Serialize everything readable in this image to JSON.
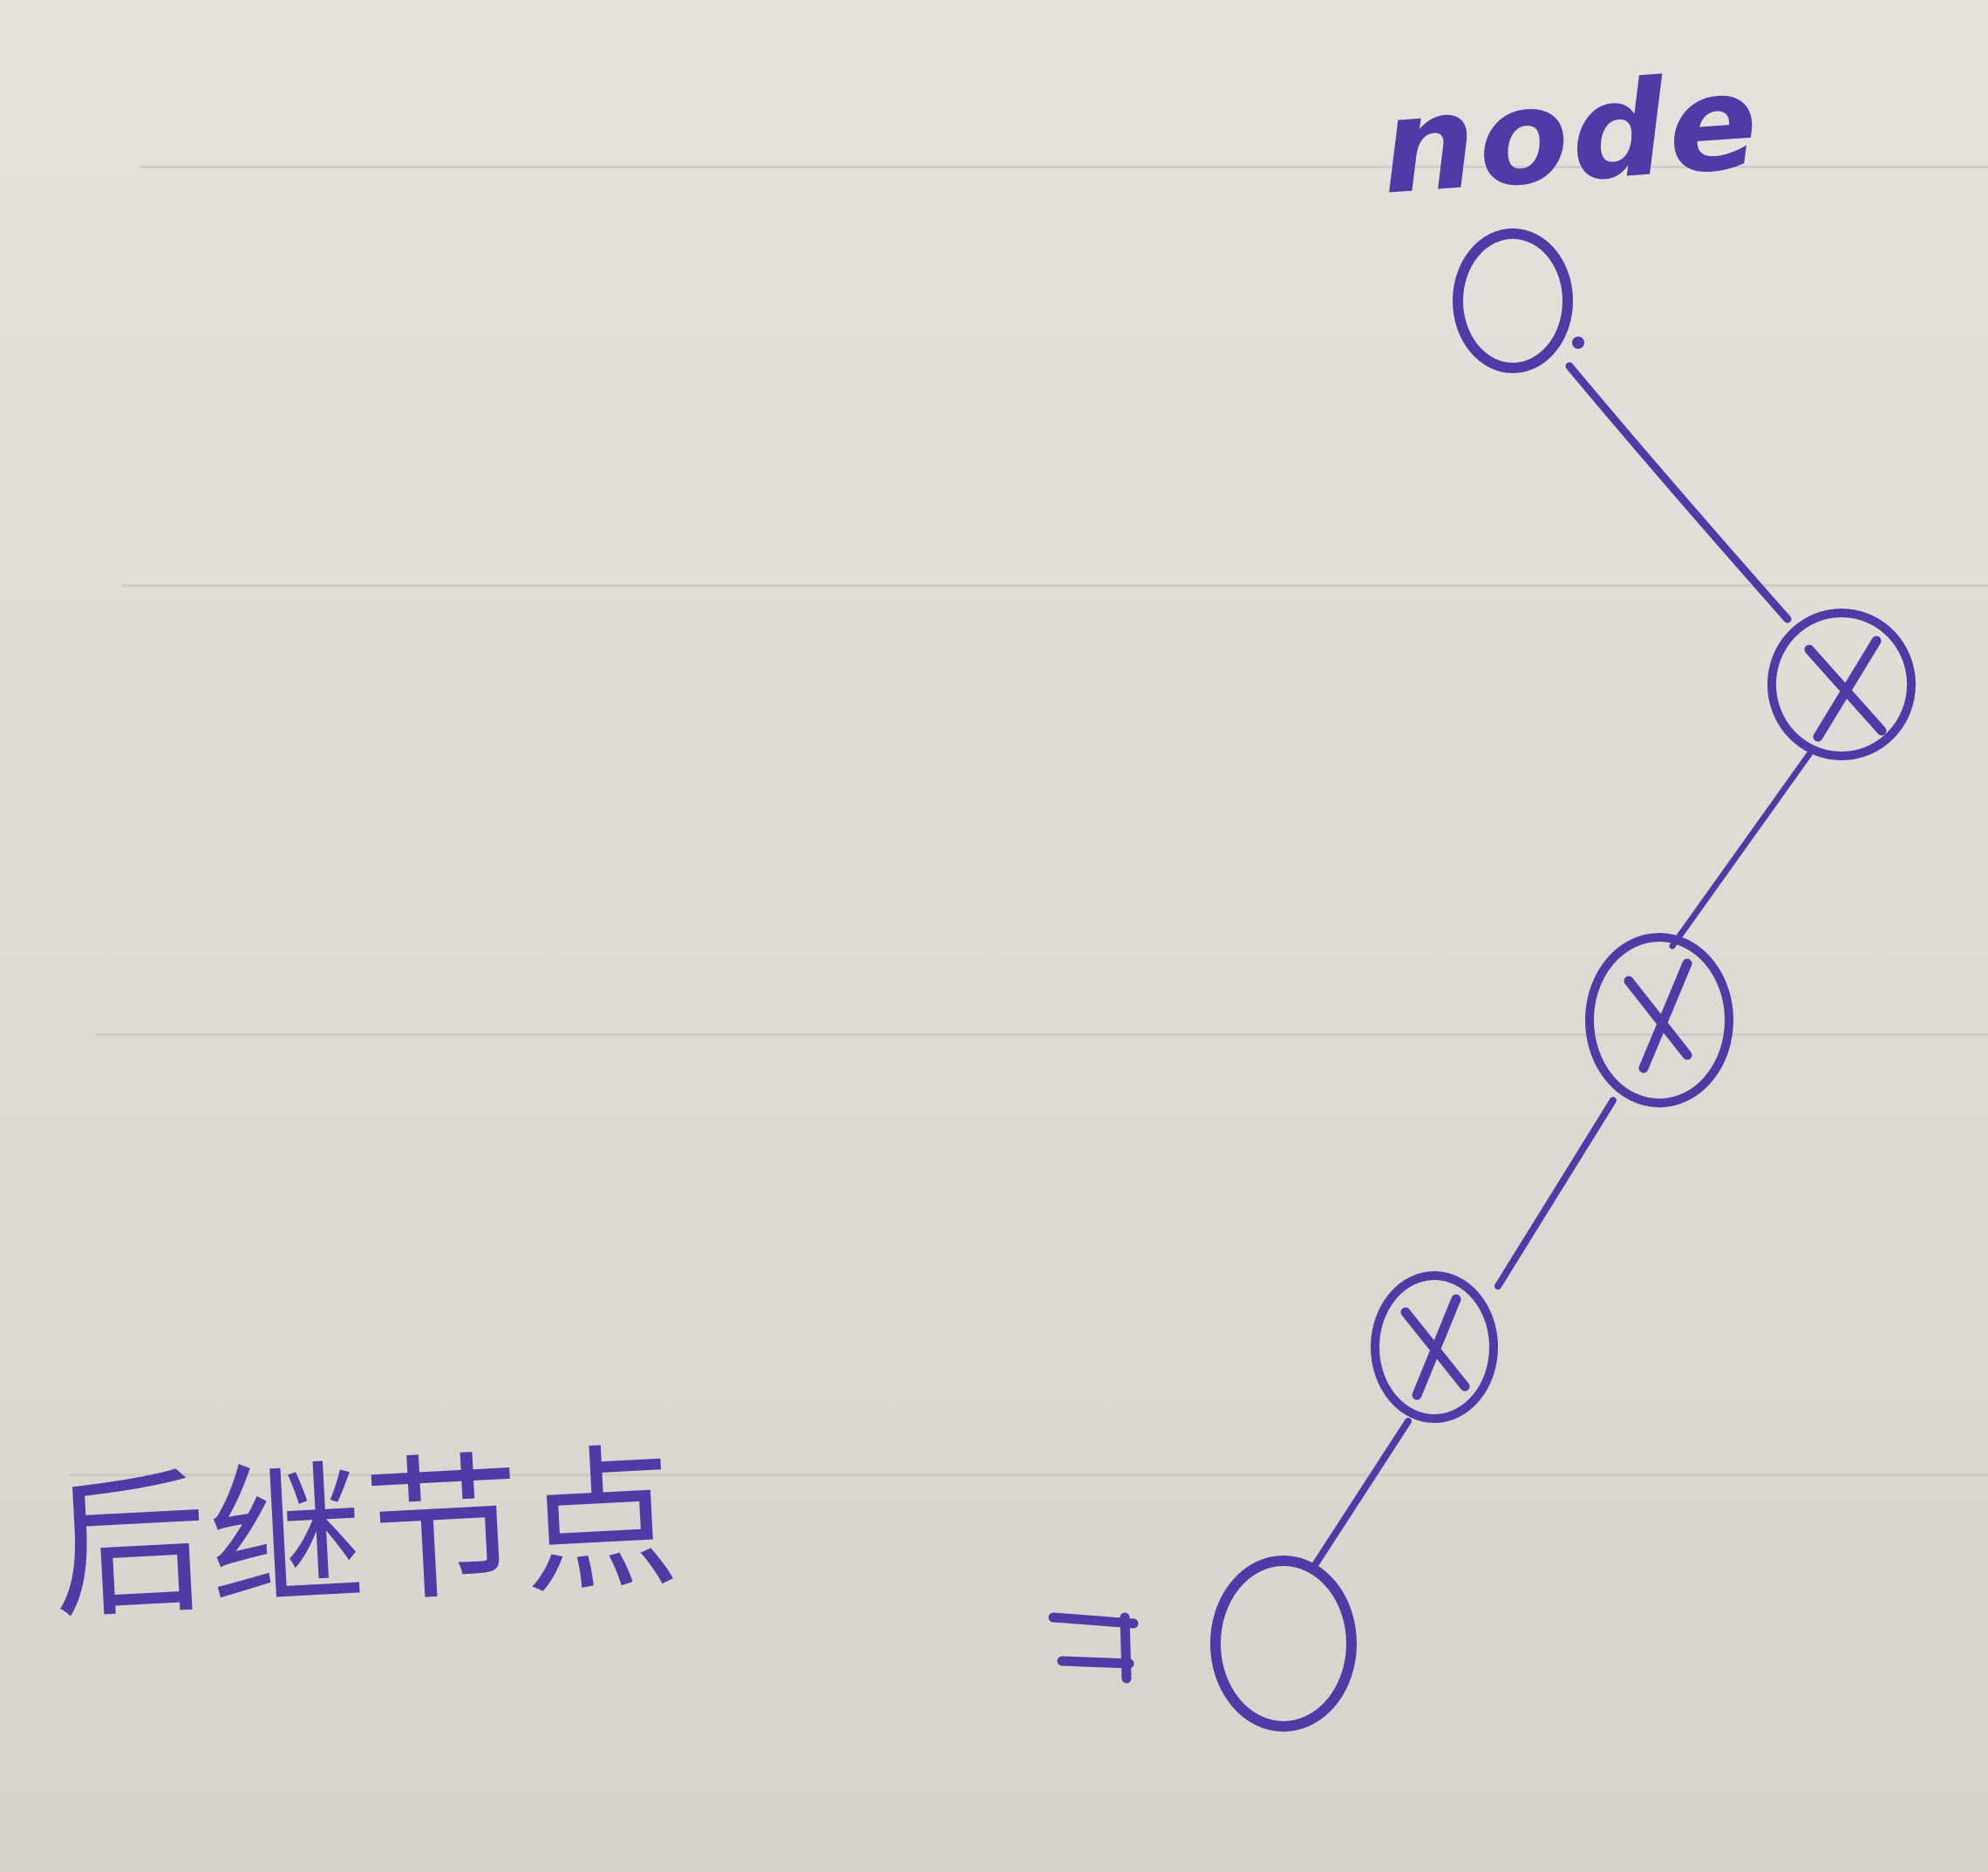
{
  "labels": {
    "top": "node",
    "bottom": "后继节点"
  },
  "nodes": [
    {
      "id": "node",
      "marked": false
    },
    {
      "id": "x1",
      "marked": true
    },
    {
      "id": "x2",
      "marked": true
    },
    {
      "id": "x3",
      "marked": true
    },
    {
      "id": "successor",
      "marked": false
    }
  ],
  "edges": [
    [
      "node",
      "x1"
    ],
    [
      "x1",
      "x2"
    ],
    [
      "x2",
      "x3"
    ],
    [
      "x3",
      "successor"
    ]
  ],
  "colors": {
    "ink": "#4f3aa6",
    "paper": "#dedcd5",
    "rule_line": "#cac7bf"
  }
}
